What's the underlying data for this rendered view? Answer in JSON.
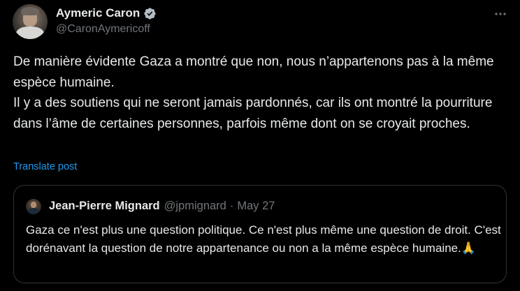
{
  "author": {
    "display_name": "Aymeric Caron",
    "handle": "@CaronAymericoff",
    "verified": true
  },
  "post": {
    "text": "De manière évidente Gaza a montré que non, nous n’appartenons pas à la même espèce humaine.\nIl y a des soutiens qui ne seront jamais pardonnés, car ils ont montré la pourriture dans l’âme de certaines personnes, parfois même dont on se croyait proches.",
    "translate_label": "Translate post"
  },
  "quoted_post": {
    "display_name": "Jean-Pierre Mignard",
    "handle": "@jpmignard",
    "separator": "·",
    "date": "May 27",
    "text": "Gaza ce n'est plus une question politique. Ce n'est plus même une question de droit.  C'est dorénavant la question de notre appartenance ou non a la même espèce humaine.🙏"
  },
  "icons": {
    "verified": "verified-badge-icon",
    "more": "more-options-icon"
  },
  "colors": {
    "background": "#000000",
    "text_primary": "#e7e9ea",
    "text_secondary": "#71767b",
    "link": "#1d9bf0",
    "border": "#2f3336"
  }
}
